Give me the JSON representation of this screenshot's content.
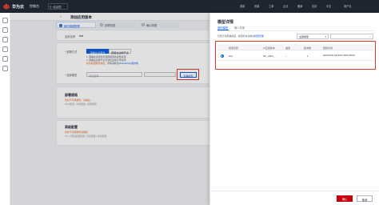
{
  "topbar": {
    "brand": "华为云",
    "console": "控制台",
    "region": "北京四",
    "right_items": [
      "费用",
      "资源",
      "工单",
      "企业",
      "备案",
      "支持",
      "中文",
      "用户名"
    ]
  },
  "page": {
    "title": "添加应用版本"
  },
  "steps": [
    {
      "num": "1",
      "label": "组件模型配置"
    },
    {
      "num": "2",
      "label": "部署配置"
    },
    {
      "num": "3",
      "label": "确认规格"
    }
  ],
  "form": {
    "app_name_label": "应用名称",
    "app_name_value": "test",
    "deploy_type_label": "* 部署方式",
    "deploy_type_options": [
      "部署在资源池",
      "部署在边缘节点"
    ],
    "deploy_hints": [
      "1. 部署在资源池可使用模型的完整资源",
      "2. 部署在边缘节点可通过边缘计算资源"
    ],
    "deploy_hint_link": "将对模型服务收费",
    "deploy_hint_suffix": "，详情请参见",
    "deploy_hint_link2": "ModelArts价格详情",
    "model_label": "* 选择模型",
    "model_placeholder": "请先选择",
    "model_select_button": "选择模型"
  },
  "sections": {
    "deploy_config": {
      "title": "部署规格",
      "sub1": "暂时不可用服务，请稍后",
      "sub2": "CPU配置 | 分布配置 | 实例配置"
    },
    "advanced": {
      "title": "高级配置",
      "sub1": "暂时不可用服务请稍后",
      "sub2": "TTL | 环境变量配置 | 日志配置 | 标签配置"
    }
  },
  "drawer": {
    "title": "模型详情",
    "tabs": [
      "我的模型",
      "他人共享"
    ],
    "hint": "仅展示可部署模型，模型状态请前往",
    "hint_link": "模型管理",
    "filter_value": "全部类型",
    "columns": [
      "模型名称",
      "AI应用版本",
      "描述",
      "版本数",
      "更新时间"
    ],
    "rows": [
      {
        "name": "test",
        "model_id": "NC_e5ph_...",
        "desc": "--",
        "versions": "1",
        "updated": "2022/10/11 18:02:07 GMT+08:00"
      }
    ],
    "ok_label": "确认",
    "cancel_label": "取消"
  },
  "colors": {
    "accent": "#0c60e1",
    "brand_red": "#c7000b",
    "highlight_box": "#e4382b",
    "topbar": "#1e2430"
  }
}
